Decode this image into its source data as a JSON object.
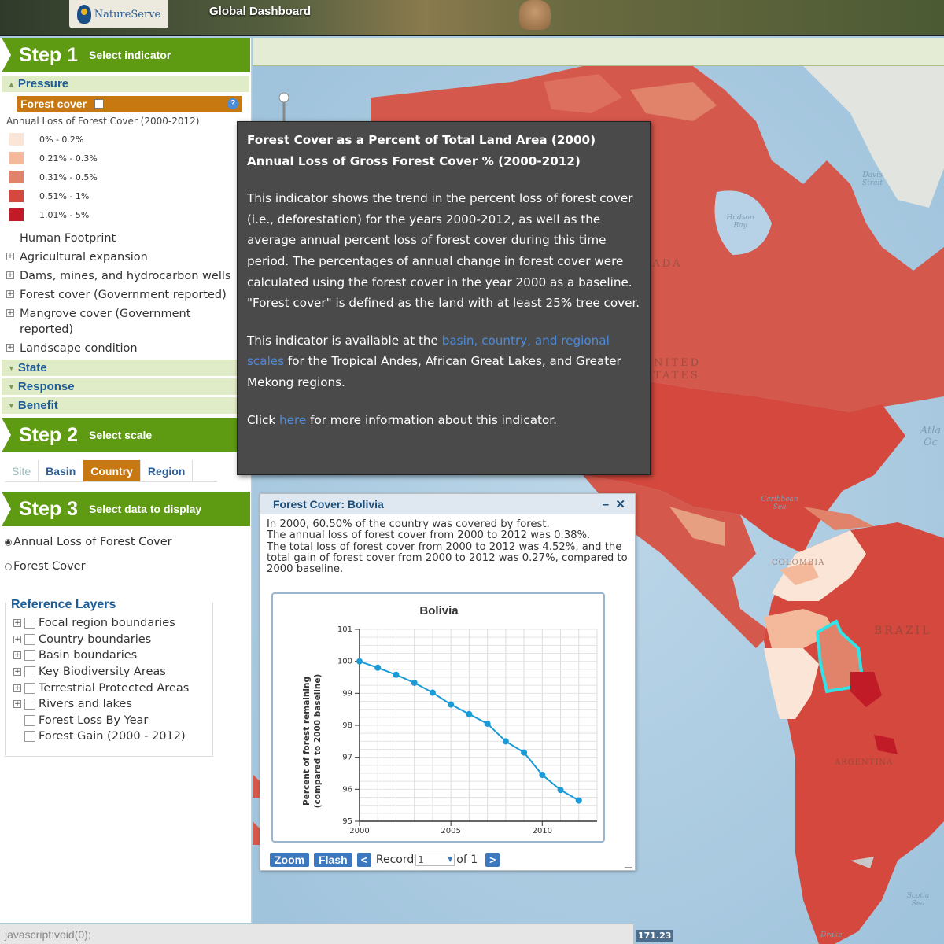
{
  "header": {
    "logo_text": "NatureServe",
    "title": "Global Dashboard"
  },
  "step1": {
    "num": "Step 1",
    "label": "Select indicator"
  },
  "step2": {
    "num": "Step 2",
    "label": "Select scale"
  },
  "step3": {
    "num": "Step 3",
    "label": "Select data to display"
  },
  "categories": {
    "pressure": "Pressure",
    "state": "State",
    "response": "Response",
    "benefit": "Benefit"
  },
  "selected_indicator": "Forest cover",
  "legend": {
    "title": "Annual Loss of Forest Cover (2000-2012)",
    "items": [
      {
        "label": "0% - 0.2%",
        "color": "#fbe5d6"
      },
      {
        "label": "0.21% - 0.3%",
        "color": "#f3b99a"
      },
      {
        "label": "0.31% - 0.5%",
        "color": "#e0836a"
      },
      {
        "label": "0.51% - 1%",
        "color": "#d4483d"
      },
      {
        "label": "1.01% - 5%",
        "color": "#c01b27"
      }
    ]
  },
  "indicators": [
    "Human Footprint",
    "Agricultural expansion",
    "Dams, mines, and hydrocarbon wells",
    "Forest cover (Government reported)",
    "Mangrove cover (Government reported)",
    "Landscape condition"
  ],
  "scales": [
    "Site",
    "Basin",
    "Country",
    "Region"
  ],
  "active_scale": "Country",
  "display_options": [
    "Annual Loss of Forest Cover",
    "Forest Cover"
  ],
  "reference": {
    "title": "Reference Layers",
    "layers": [
      "Focal region boundaries",
      "Country boundaries",
      "Basin boundaries",
      "Key Biodiversity Areas",
      "Terrestrial Protected Areas",
      "Rivers and lakes",
      "Forest Loss By Year",
      "Forest Gain (2000 - 2012)"
    ]
  },
  "status_text": "javascript:void(0);",
  "coord_text": "171.23",
  "tooltip": {
    "title1": "Forest Cover as a Percent of Total Land Area (2000)",
    "title2": "Annual Loss of Gross Forest Cover % (2000-2012)",
    "para1": "This indicator shows the trend in the percent loss of forest cover (i.e., deforestation) for the years 2000-2012, as well as the average annual percent loss of forest cover during this time period. The percentages of annual change in forest cover were calculated using the forest cover in the year 2000 as a baseline. \"Forest cover\" is defined as the land with at least 25% tree cover.",
    "para2_a": "This indicator is available at the ",
    "para2_link": "basin, country, and regional scales",
    "para2_b": " for the Tropical Andes, African Great Lakes, and Greater Mekong regions.",
    "para3_a": "Click ",
    "para3_link": "here",
    "para3_b": " for more information about this indicator."
  },
  "popup": {
    "title": "Forest Cover: Bolivia",
    "text1": "In 2000, 60.50% of the country was covered by forest.",
    "text2": "The annual loss of forest cover from 2000 to 2012 was 0.38%.",
    "text3": "The total loss of forest cover from 2000 to 2012 was 4.52%, and the total gain of forest cover from 2000 to 2012 was 0.27%, compared to 2000 baseline.",
    "zoom": "Zoom",
    "flash": "Flash",
    "record_label": "Record",
    "record_value": "1",
    "of_label": "of 1"
  },
  "map_labels": {
    "canada": "NADA",
    "usa1": "NITED",
    "usa2": "TATES",
    "brazil": "BRAZIL",
    "colombia": "COLOMBIA",
    "argentina": "ARGENTINA",
    "hudson": "Hudson Bay",
    "davis": "Davis Strait",
    "caribbean": "Caribbean Sea",
    "atlantic": "Atla Oc",
    "drake": "Drake",
    "scotia": "Scotia Sea"
  },
  "chart_data": {
    "type": "line",
    "title": "Bolivia",
    "xlabel": "",
    "ylabel": "Percent of forest remaining (compared to 2000 baseline)",
    "xlim": [
      2000,
      2013
    ],
    "ylim": [
      95,
      101
    ],
    "x_ticks": [
      2000,
      2005,
      2010
    ],
    "y_ticks": [
      95,
      96,
      97,
      98,
      99,
      100,
      101
    ],
    "grid": true,
    "series": [
      {
        "color": "#1a9ad6",
        "x": [
          2000,
          2001,
          2002,
          2003,
          2004,
          2005,
          2006,
          2007,
          2008,
          2009,
          2010,
          2011,
          2012
        ],
        "y": [
          100,
          99.8,
          99.58,
          99.33,
          99.02,
          98.65,
          98.35,
          98.05,
          97.5,
          97.15,
          96.45,
          95.98,
          95.65
        ]
      }
    ]
  }
}
